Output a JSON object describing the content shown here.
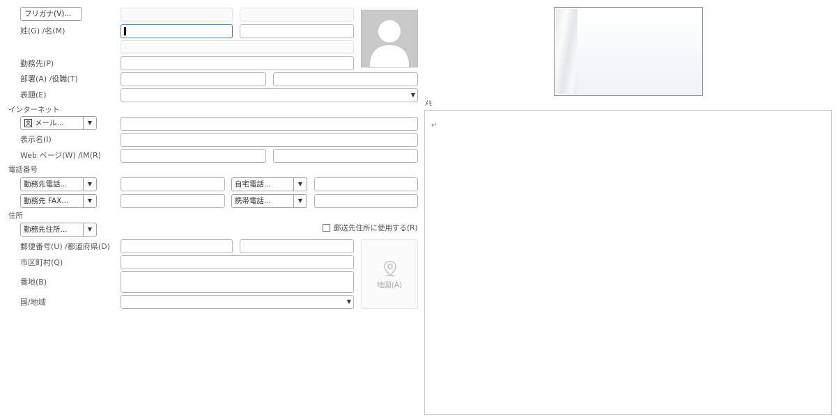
{
  "name_section": {
    "furigana_button": "フリガナ(V)...",
    "name_label": "姓(G) /名(M)"
  },
  "company": {
    "label": "勤務先(P)"
  },
  "dept": {
    "label": "部署(A) /役職(T)"
  },
  "file_as": {
    "label": "表題(E)"
  },
  "internet": {
    "section_label": "インターネット",
    "email_button": "メール...",
    "display_label": "表示名(I)",
    "web_label": "Web ページ(W) /IM(R)"
  },
  "phone": {
    "section_label": "電話番号",
    "phone1": "勤務先電話...",
    "phone2": "自宅電話...",
    "phone3": "勤務先 FAX...",
    "phone4": "携帯電話..."
  },
  "address": {
    "section_label": "住所",
    "type_dropdown": "勤務先住所...",
    "mailing_checkbox_label": "郵送先住所に使用する(R)",
    "mailing_checked": false,
    "zip_label": "郵便番号(U) /都道府県(D)",
    "city_label": "市区町村(Q)",
    "street_label": "番地(B)",
    "country_label": "国/地域",
    "map_button": "地図(A)"
  },
  "notes": {
    "label": "ﾒﾓ",
    "content": "↵"
  },
  "colors": {
    "focus_border": "#2a7fc8",
    "field_border": "#aeb3b8",
    "photo_bg": "#c9c9c9"
  }
}
